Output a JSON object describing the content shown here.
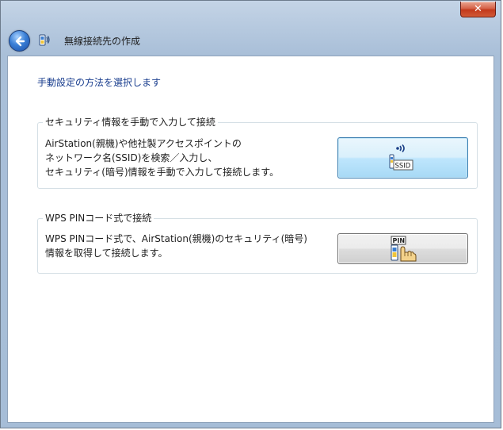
{
  "window": {
    "close_label": "✕"
  },
  "header": {
    "title": "無線接続先の作成",
    "back_icon": "back-arrow-icon",
    "app_icon": "wireless-person-icon"
  },
  "main": {
    "instruction": "手動設定の方法を選択します",
    "manual_group": {
      "legend": "セキュリティ情報を手動で入力して接続",
      "desc_lines": [
        "AirStation(親機)や他社製アクセスポイントの",
        "ネットワーク名(SSID)を検索／入力し、",
        "セキュリティ(暗号)情報を手動で入力して接続します。"
      ],
      "button_icon": "ssid-wireless-icon",
      "button_icon_text": "SSID"
    },
    "wps_group": {
      "legend": "WPS PINコード式で接続",
      "desc_lines": [
        "WPS PINコード式で、AirStation(親機)のセキュリティ(暗号)",
        "情報を取得して接続します。"
      ],
      "button_icon": "pin-hand-icon",
      "button_icon_text": "PIN"
    }
  },
  "colors": {
    "instruction_text": "#1b3f8f",
    "frame": "#a9bfd8",
    "hover_button": "#bee6fd",
    "close_button": "#c2391c"
  }
}
